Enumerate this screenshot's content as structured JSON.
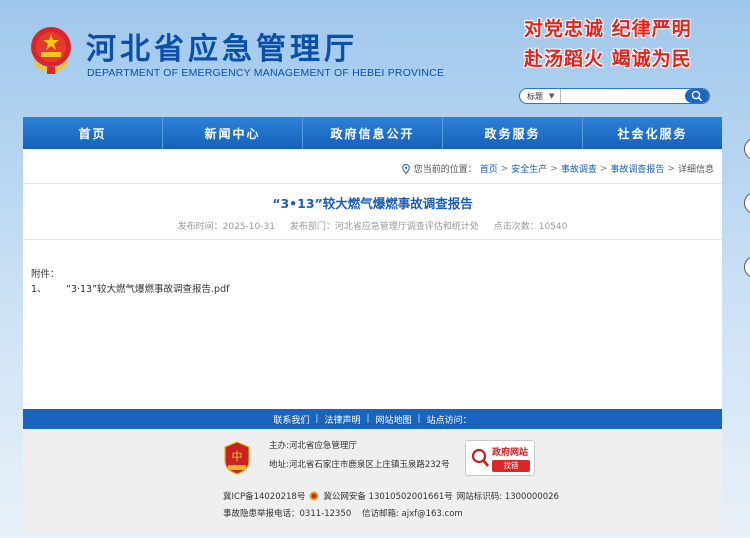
{
  "header": {
    "title": "河北省应急管理厅",
    "subtitle": "DEPARTMENT OF EMERGENCY MANAGEMENT OF HEBEI PROVINCE",
    "slogan_line1": "对党忠诚 纪律严明",
    "slogan_line2": "赴汤蹈火 竭诚为民"
  },
  "search": {
    "scope_label": "标题",
    "placeholder": ""
  },
  "nav": {
    "items": [
      {
        "label": "首页"
      },
      {
        "label": "新闻中心"
      },
      {
        "label": "政府信息公开"
      },
      {
        "label": "政务服务"
      },
      {
        "label": "社会化服务"
      }
    ]
  },
  "breadcrumb": {
    "prefix": "您当前的位置：",
    "items": [
      "首页",
      "安全生产",
      "事故调查",
      "事故调查报告"
    ],
    "current": "详细信息",
    "separator": ">"
  },
  "article": {
    "title": "“3•13”较大燃气爆燃事故调查报告",
    "publish_time": "发布时间：2025-10-31",
    "department": "发布部门：河北省应急管理厅调查评估和统计处",
    "views": "点击次数：10540",
    "attachment_label": "附件：",
    "attachments": [
      {
        "index": "1、",
        "name": "“3·13”较大燃气爆燃事故调查报告.pdf"
      }
    ]
  },
  "footer": {
    "links": [
      "联系我们",
      "法律声明",
      "网站地图",
      "站点访问："
    ],
    "host": "主办:河北省应急管理厅",
    "address": "地址:河北省石家庄市鹿泉区上庄镇玉泉路232号",
    "gov_badge_title": "政府网站",
    "gov_badge_button": "找错",
    "icp": "冀ICP备14020218号",
    "police": "冀公网安备 13010502001661号",
    "site_code": "网站标识码: 1300000026",
    "hotline": "事故隐患举报电话：0311-12350",
    "email": "信访邮箱: ajxf@163.com",
    "party_badge_text": "党政机关"
  },
  "colors": {
    "primary": "#1b64bd",
    "title_blue": "#0a4fa8",
    "slogan_red": "#e3231b"
  }
}
